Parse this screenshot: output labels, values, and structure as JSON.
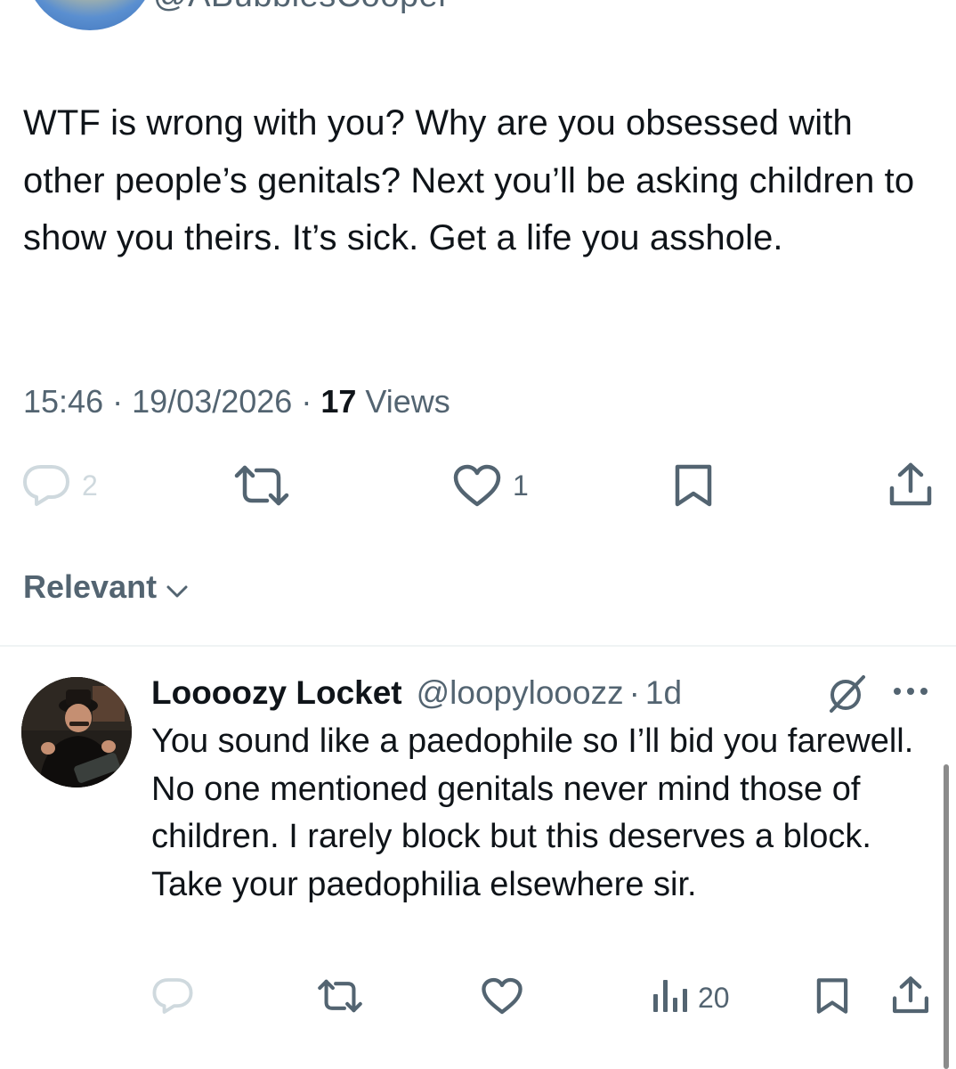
{
  "original_tweet": {
    "handle": "@ABubblesCooper",
    "text": "WTF is wrong with you? Why are you obsessed with other people’s genitals? Next you’ll be asking children to show you theirs. It’s sick. Get a life you asshole.",
    "time": "15:46",
    "separator": "·",
    "date": "19/03/2026",
    "views_count": "17",
    "views_label": "Views",
    "reply_count": "2",
    "like_count": "1"
  },
  "replies_sort": {
    "label": "Relevant"
  },
  "reply": {
    "name": "Loooozy Locket",
    "handle": "@loopylooozz",
    "separator": "·",
    "time": "1d",
    "text": "You sound like a paedophile so I’ll bid you farewell. No one mentioned genitals never mind those of children. I rarely block but this deserves a block. Take your paedophilia elsewhere sir.",
    "views_count": "20"
  },
  "icons": {
    "reply": "speech-bubble-icon",
    "retweet": "retweet-icon",
    "like": "heart-icon",
    "bookmark": "bookmark-icon",
    "share": "share-icon",
    "views": "bar-chart-icon",
    "grok": "grok-icon",
    "more": "more-icon"
  },
  "colors": {
    "text_primary": "#0f1419",
    "text_secondary": "#536471",
    "divider": "#eff3f4",
    "disabled_icon": "#cfd9de"
  }
}
